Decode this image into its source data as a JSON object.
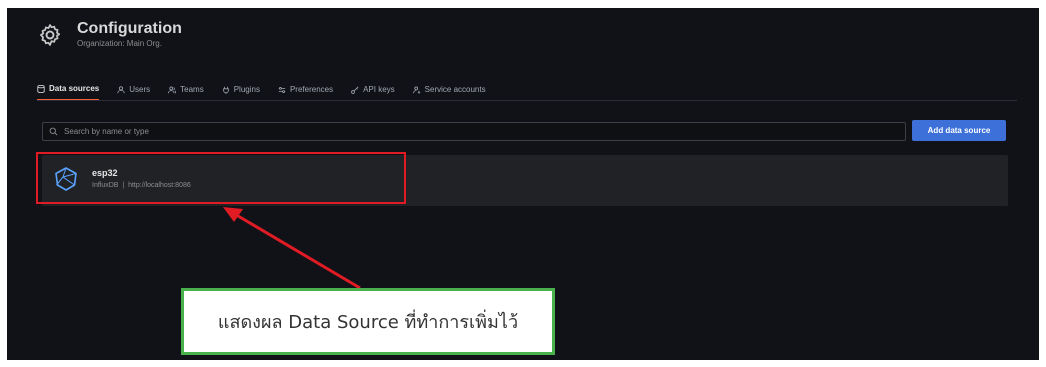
{
  "header": {
    "title": "Configuration",
    "subtitle": "Organization: Main Org."
  },
  "tabs": [
    {
      "label": "Data sources",
      "icon": "database-icon",
      "active": true
    },
    {
      "label": "Users",
      "icon": "user-icon"
    },
    {
      "label": "Teams",
      "icon": "users-icon"
    },
    {
      "label": "Plugins",
      "icon": "plug-icon"
    },
    {
      "label": "Preferences",
      "icon": "sliders-icon"
    },
    {
      "label": "API keys",
      "icon": "key-icon"
    },
    {
      "label": "Service accounts",
      "icon": "service-account-icon"
    }
  ],
  "search": {
    "placeholder": "Search by name or type"
  },
  "actions": {
    "add_label": "Add data source"
  },
  "datasource": {
    "name": "esp32",
    "type": "InfluxDB",
    "url": "http://localhost:8086",
    "separator": "|"
  },
  "callout": {
    "text": "แสดงผล Data Source ที่ทำการเพิ่มไว้"
  },
  "colors": {
    "background": "#111217",
    "row": "#202226",
    "accent": "#f55f3e",
    "primary": "#3d71d9",
    "highlight": "#e01b24",
    "callout_border": "#49b14b"
  }
}
